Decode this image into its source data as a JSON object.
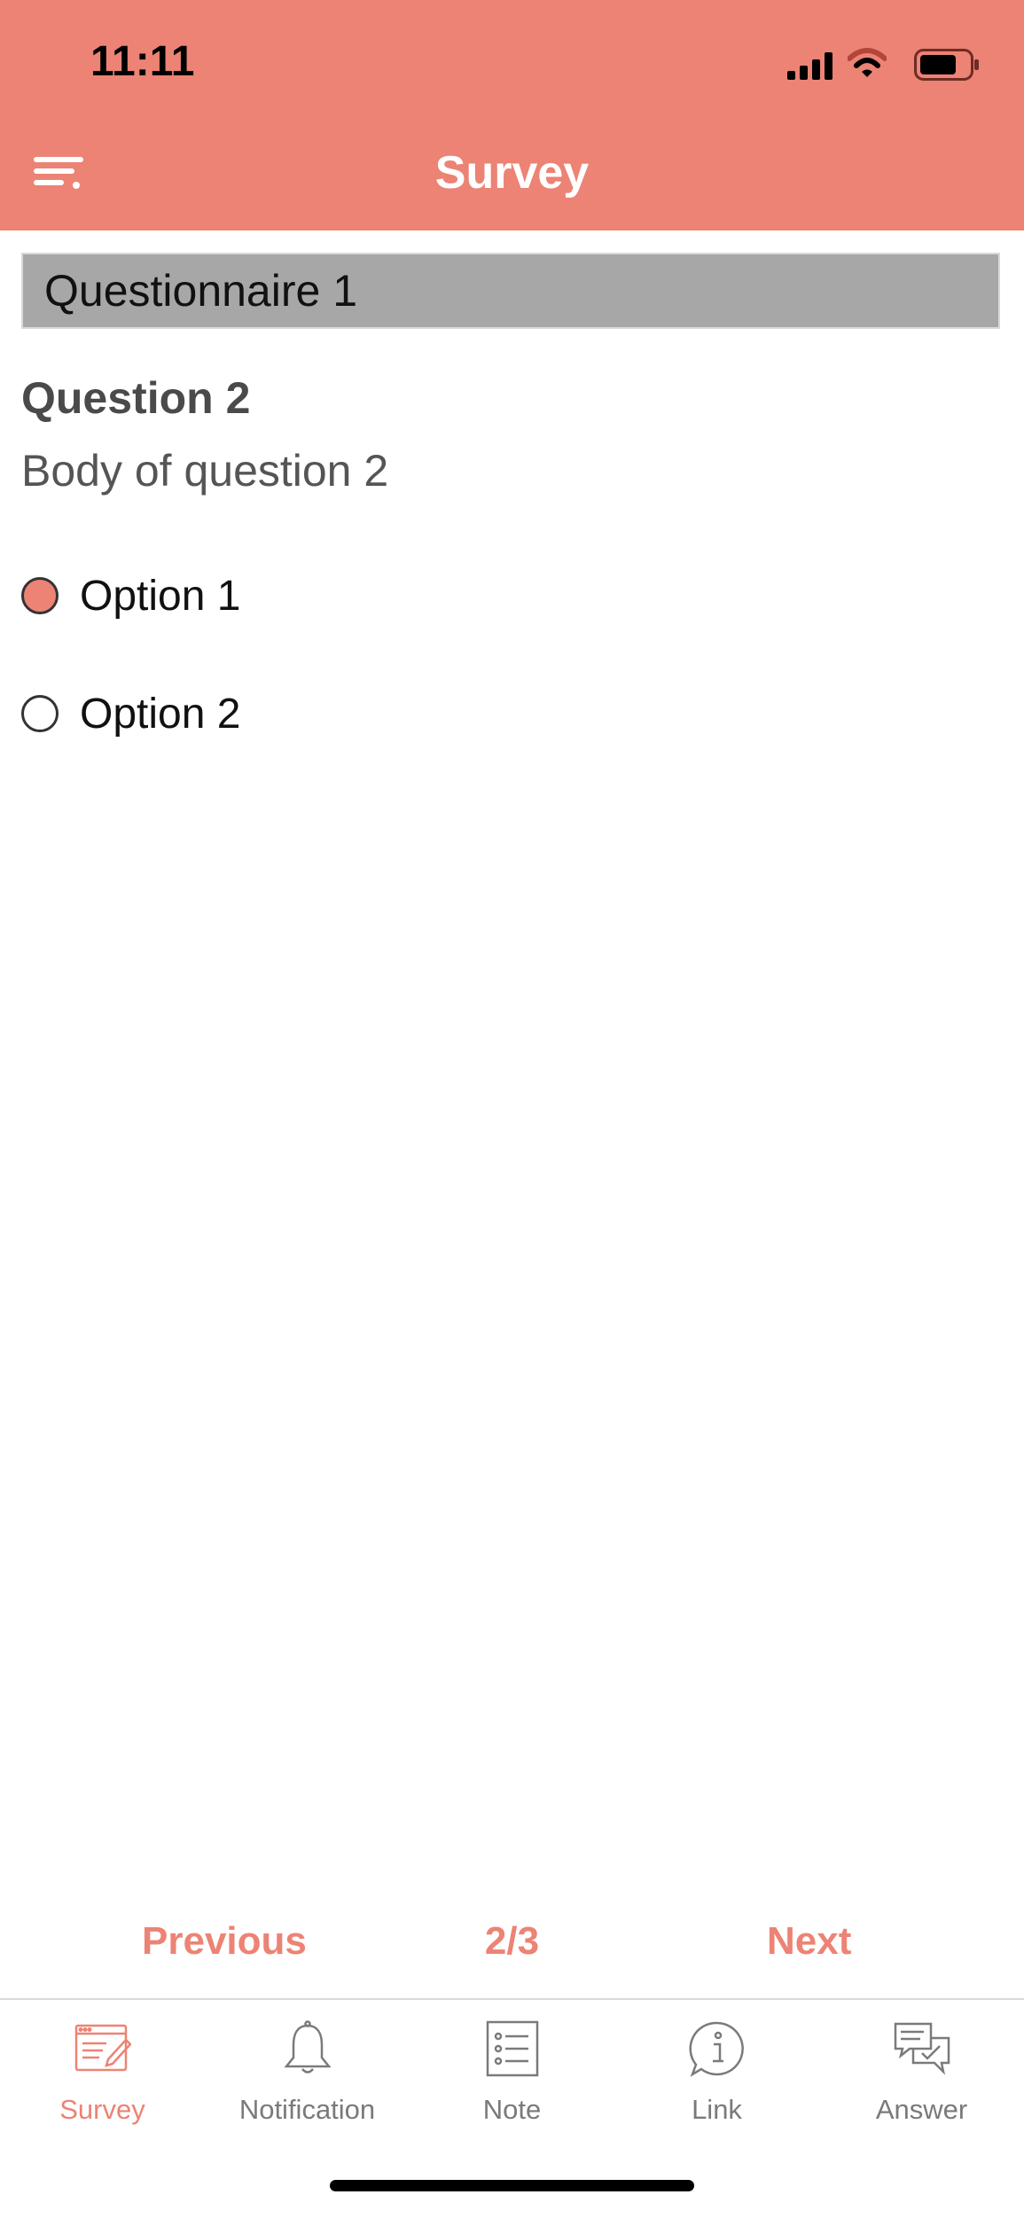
{
  "status_bar": {
    "time": "11:11"
  },
  "header": {
    "title": "Survey",
    "menu_icon": "menu-icon",
    "color": "#EC8374"
  },
  "questionnaire": {
    "title": "Questionnaire 1"
  },
  "question": {
    "title": "Question 2",
    "body": "Body of question 2",
    "options": [
      {
        "label": "Option 1",
        "selected": true
      },
      {
        "label": "Option 2",
        "selected": false
      }
    ]
  },
  "pager": {
    "previous_label": "Previous",
    "count": "2/3",
    "next_label": "Next"
  },
  "tab_bar": {
    "tabs": [
      {
        "label": "Survey",
        "icon": "survey-icon",
        "active": true
      },
      {
        "label": "Notification",
        "icon": "bell-icon",
        "active": false
      },
      {
        "label": "Note",
        "icon": "note-list-icon",
        "active": false
      },
      {
        "label": "Link",
        "icon": "info-icon",
        "active": false
      },
      {
        "label": "Answer",
        "icon": "chat-check-icon",
        "active": false
      }
    ]
  }
}
